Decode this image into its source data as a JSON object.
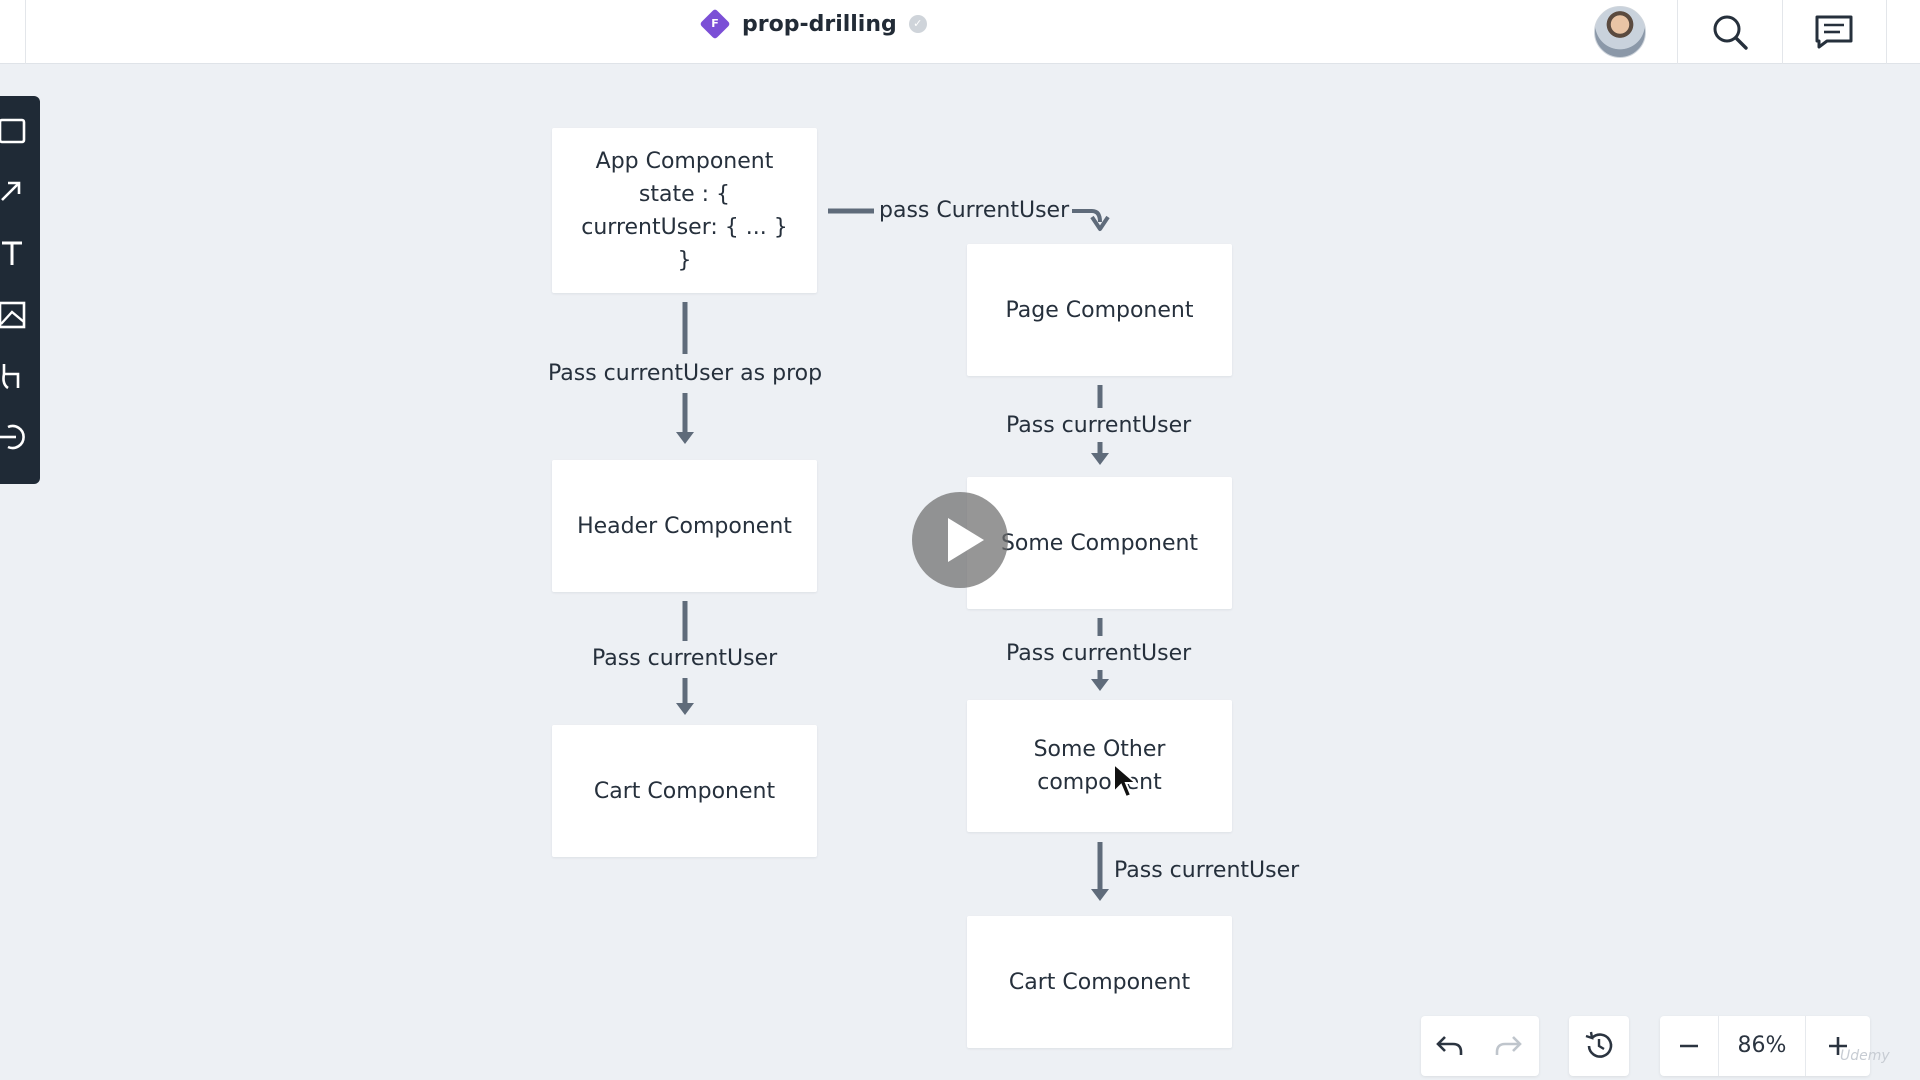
{
  "header": {
    "file_badge_letter": "F",
    "title": "prop-drilling",
    "brand_color": "#7b4fd6"
  },
  "toolbar": {
    "tools": [
      "rectangle-tool-icon",
      "arrow-tool-icon",
      "text-tool-icon",
      "image-tool-icon",
      "pen-tool-icon",
      "logout-icon"
    ]
  },
  "diagram": {
    "nodes": {
      "app": "App Component\nstate : {\ncurrentUser: { ... }\n}",
      "header": "Header Component",
      "cart_left": "Cart Component",
      "page": "Page Component",
      "some": "Some Component",
      "some_other": "Some Other\ncomponent",
      "cart_right": "Cart Component"
    },
    "labels": {
      "app_to_page": "pass CurrentUser",
      "app_to_header": "Pass currentUser as prop",
      "header_to_cart": "Pass currentUser",
      "page_to_some": "Pass currentUser",
      "some_to_other": "Pass currentUser",
      "other_to_cart": "Pass currentUser"
    }
  },
  "controls": {
    "zoom": "86%",
    "watermark": "Udemy"
  }
}
